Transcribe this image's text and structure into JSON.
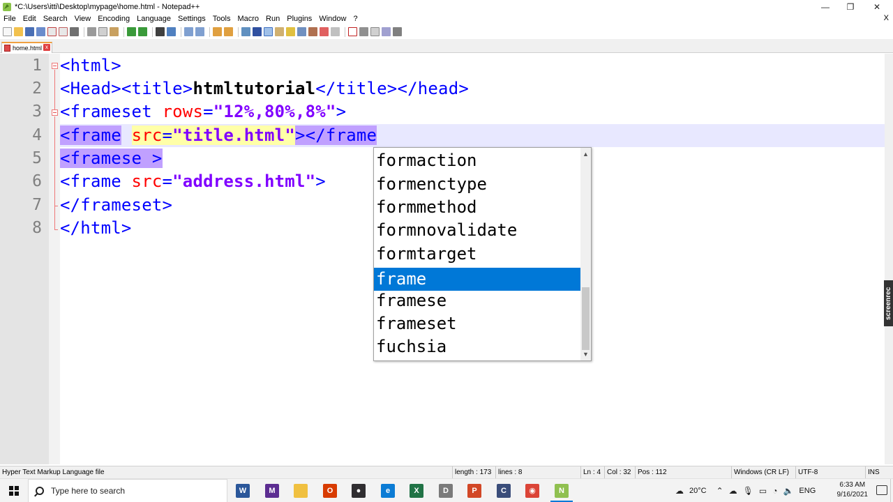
{
  "window": {
    "title": "*C:\\Users\\itti\\Desktop\\mypage\\home.html - Notepad++",
    "controls": [
      "—",
      "❐",
      "✕"
    ]
  },
  "menu": {
    "items": [
      "File",
      "Edit",
      "Search",
      "View",
      "Encoding",
      "Language",
      "Settings",
      "Tools",
      "Macro",
      "Run",
      "Plugins",
      "Window",
      "?"
    ],
    "close_doc": "X"
  },
  "tab": {
    "label": "home.html",
    "close": "x"
  },
  "editor": {
    "line_numbers": [
      "1",
      "2",
      "3",
      "4",
      "5",
      "6",
      "7",
      "8"
    ],
    "lines": {
      "l1": {
        "open": "<html>"
      },
      "l2": {
        "a": "<Head><title>",
        "b": "htmltutorial",
        "c": "</title></head>"
      },
      "l3": {
        "a": "<frameset ",
        "attr": "rows",
        "eq": "=",
        "val": "\"12%,80%,8%\"",
        "close": ">"
      },
      "l4": {
        "a": "<frame",
        "sp": " ",
        "attr": "src",
        "eq": "=",
        "val": "\"title.html\"",
        "b": "></frame"
      },
      "l5": {
        "a": "<framese >"
      },
      "l6": {
        "a": "<frame ",
        "attr": "src",
        "eq": "=",
        "val": "\"address.html\"",
        "b": ">"
      },
      "l7": {
        "a": "</frameset>"
      },
      "l8": {
        "a": "</html>"
      }
    }
  },
  "autocomplete": {
    "items": [
      "formaction",
      "formenctype",
      "formmethod",
      "formnovalidate",
      "formtarget",
      "frame",
      "framese",
      "frameset",
      "fuchsia"
    ],
    "selected": "frame",
    "scroll_up": "▲",
    "scroll_down": "▼"
  },
  "statusbar": {
    "file_type": "Hyper Text Markup Language file",
    "length": "length : 173",
    "lines": "lines : 8",
    "ln": "Ln : 4",
    "col": "Col : 32",
    "pos": "Pos : 112",
    "eol": "Windows (CR LF)",
    "encoding": "UTF-8",
    "mode": "INS"
  },
  "taskbar": {
    "search_placeholder": "Type here to search",
    "apps": [
      {
        "name": "word-icon",
        "label": "W",
        "color": "#2b579a"
      },
      {
        "name": "visual-studio-icon",
        "label": "M",
        "color": "#5c2d91"
      },
      {
        "name": "file-explorer-icon",
        "label": "",
        "color": "#f0c040"
      },
      {
        "name": "office-icon",
        "label": "O",
        "color": "#d83b01"
      },
      {
        "name": "obs-icon",
        "label": "●",
        "color": "#302e31"
      },
      {
        "name": "edge-icon",
        "label": "e",
        "color": "#0c7cd5"
      },
      {
        "name": "excel-icon",
        "label": "X",
        "color": "#217346"
      },
      {
        "name": "dosbox-icon",
        "label": "D",
        "color": "#7a7a7a"
      },
      {
        "name": "powerpoint-icon",
        "label": "P",
        "color": "#d24726"
      },
      {
        "name": "devcpp-icon",
        "label": "C",
        "color": "#3a4d7a"
      },
      {
        "name": "chrome-icon",
        "label": "◉",
        "color": "#db4437"
      },
      {
        "name": "notepadpp-icon",
        "label": "N",
        "color": "#90c050"
      }
    ],
    "weather": "20°C",
    "language": "ENG",
    "time": "6:33 AM",
    "date": "9/16/2021"
  },
  "watermark": "screenrec"
}
